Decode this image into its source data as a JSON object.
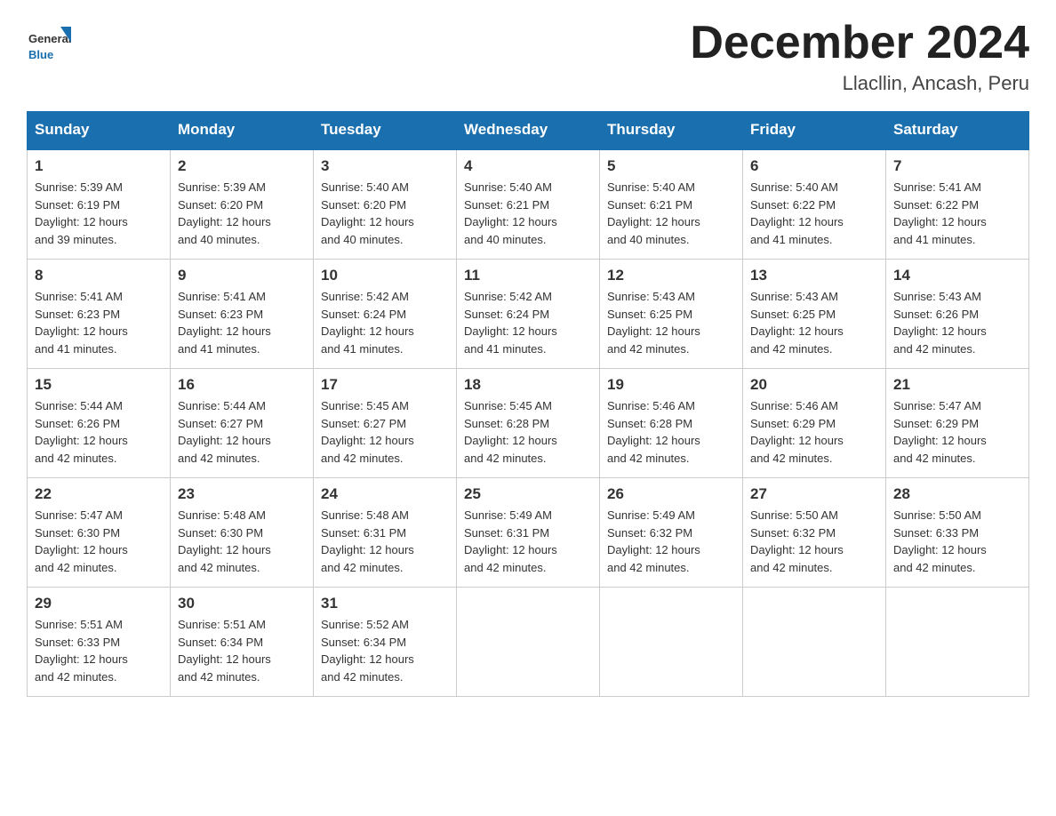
{
  "logo": {
    "general": "General",
    "blue": "Blue"
  },
  "title": {
    "month_year": "December 2024",
    "location": "Llacllin, Ancash, Peru"
  },
  "header": {
    "days": [
      "Sunday",
      "Monday",
      "Tuesday",
      "Wednesday",
      "Thursday",
      "Friday",
      "Saturday"
    ]
  },
  "weeks": [
    [
      {
        "day": "1",
        "sunrise": "5:39 AM",
        "sunset": "6:19 PM",
        "daylight": "12 hours and 39 minutes."
      },
      {
        "day": "2",
        "sunrise": "5:39 AM",
        "sunset": "6:20 PM",
        "daylight": "12 hours and 40 minutes."
      },
      {
        "day": "3",
        "sunrise": "5:40 AM",
        "sunset": "6:20 PM",
        "daylight": "12 hours and 40 minutes."
      },
      {
        "day": "4",
        "sunrise": "5:40 AM",
        "sunset": "6:21 PM",
        "daylight": "12 hours and 40 minutes."
      },
      {
        "day": "5",
        "sunrise": "5:40 AM",
        "sunset": "6:21 PM",
        "daylight": "12 hours and 40 minutes."
      },
      {
        "day": "6",
        "sunrise": "5:40 AM",
        "sunset": "6:22 PM",
        "daylight": "12 hours and 41 minutes."
      },
      {
        "day": "7",
        "sunrise": "5:41 AM",
        "sunset": "6:22 PM",
        "daylight": "12 hours and 41 minutes."
      }
    ],
    [
      {
        "day": "8",
        "sunrise": "5:41 AM",
        "sunset": "6:23 PM",
        "daylight": "12 hours and 41 minutes."
      },
      {
        "day": "9",
        "sunrise": "5:41 AM",
        "sunset": "6:23 PM",
        "daylight": "12 hours and 41 minutes."
      },
      {
        "day": "10",
        "sunrise": "5:42 AM",
        "sunset": "6:24 PM",
        "daylight": "12 hours and 41 minutes."
      },
      {
        "day": "11",
        "sunrise": "5:42 AM",
        "sunset": "6:24 PM",
        "daylight": "12 hours and 41 minutes."
      },
      {
        "day": "12",
        "sunrise": "5:43 AM",
        "sunset": "6:25 PM",
        "daylight": "12 hours and 42 minutes."
      },
      {
        "day": "13",
        "sunrise": "5:43 AM",
        "sunset": "6:25 PM",
        "daylight": "12 hours and 42 minutes."
      },
      {
        "day": "14",
        "sunrise": "5:43 AM",
        "sunset": "6:26 PM",
        "daylight": "12 hours and 42 minutes."
      }
    ],
    [
      {
        "day": "15",
        "sunrise": "5:44 AM",
        "sunset": "6:26 PM",
        "daylight": "12 hours and 42 minutes."
      },
      {
        "day": "16",
        "sunrise": "5:44 AM",
        "sunset": "6:27 PM",
        "daylight": "12 hours and 42 minutes."
      },
      {
        "day": "17",
        "sunrise": "5:45 AM",
        "sunset": "6:27 PM",
        "daylight": "12 hours and 42 minutes."
      },
      {
        "day": "18",
        "sunrise": "5:45 AM",
        "sunset": "6:28 PM",
        "daylight": "12 hours and 42 minutes."
      },
      {
        "day": "19",
        "sunrise": "5:46 AM",
        "sunset": "6:28 PM",
        "daylight": "12 hours and 42 minutes."
      },
      {
        "day": "20",
        "sunrise": "5:46 AM",
        "sunset": "6:29 PM",
        "daylight": "12 hours and 42 minutes."
      },
      {
        "day": "21",
        "sunrise": "5:47 AM",
        "sunset": "6:29 PM",
        "daylight": "12 hours and 42 minutes."
      }
    ],
    [
      {
        "day": "22",
        "sunrise": "5:47 AM",
        "sunset": "6:30 PM",
        "daylight": "12 hours and 42 minutes."
      },
      {
        "day": "23",
        "sunrise": "5:48 AM",
        "sunset": "6:30 PM",
        "daylight": "12 hours and 42 minutes."
      },
      {
        "day": "24",
        "sunrise": "5:48 AM",
        "sunset": "6:31 PM",
        "daylight": "12 hours and 42 minutes."
      },
      {
        "day": "25",
        "sunrise": "5:49 AM",
        "sunset": "6:31 PM",
        "daylight": "12 hours and 42 minutes."
      },
      {
        "day": "26",
        "sunrise": "5:49 AM",
        "sunset": "6:32 PM",
        "daylight": "12 hours and 42 minutes."
      },
      {
        "day": "27",
        "sunrise": "5:50 AM",
        "sunset": "6:32 PM",
        "daylight": "12 hours and 42 minutes."
      },
      {
        "day": "28",
        "sunrise": "5:50 AM",
        "sunset": "6:33 PM",
        "daylight": "12 hours and 42 minutes."
      }
    ],
    [
      {
        "day": "29",
        "sunrise": "5:51 AM",
        "sunset": "6:33 PM",
        "daylight": "12 hours and 42 minutes."
      },
      {
        "day": "30",
        "sunrise": "5:51 AM",
        "sunset": "6:34 PM",
        "daylight": "12 hours and 42 minutes."
      },
      {
        "day": "31",
        "sunrise": "5:52 AM",
        "sunset": "6:34 PM",
        "daylight": "12 hours and 42 minutes."
      },
      null,
      null,
      null,
      null
    ]
  ],
  "labels": {
    "sunrise": "Sunrise: ",
    "sunset": "Sunset: ",
    "daylight": "Daylight: "
  }
}
